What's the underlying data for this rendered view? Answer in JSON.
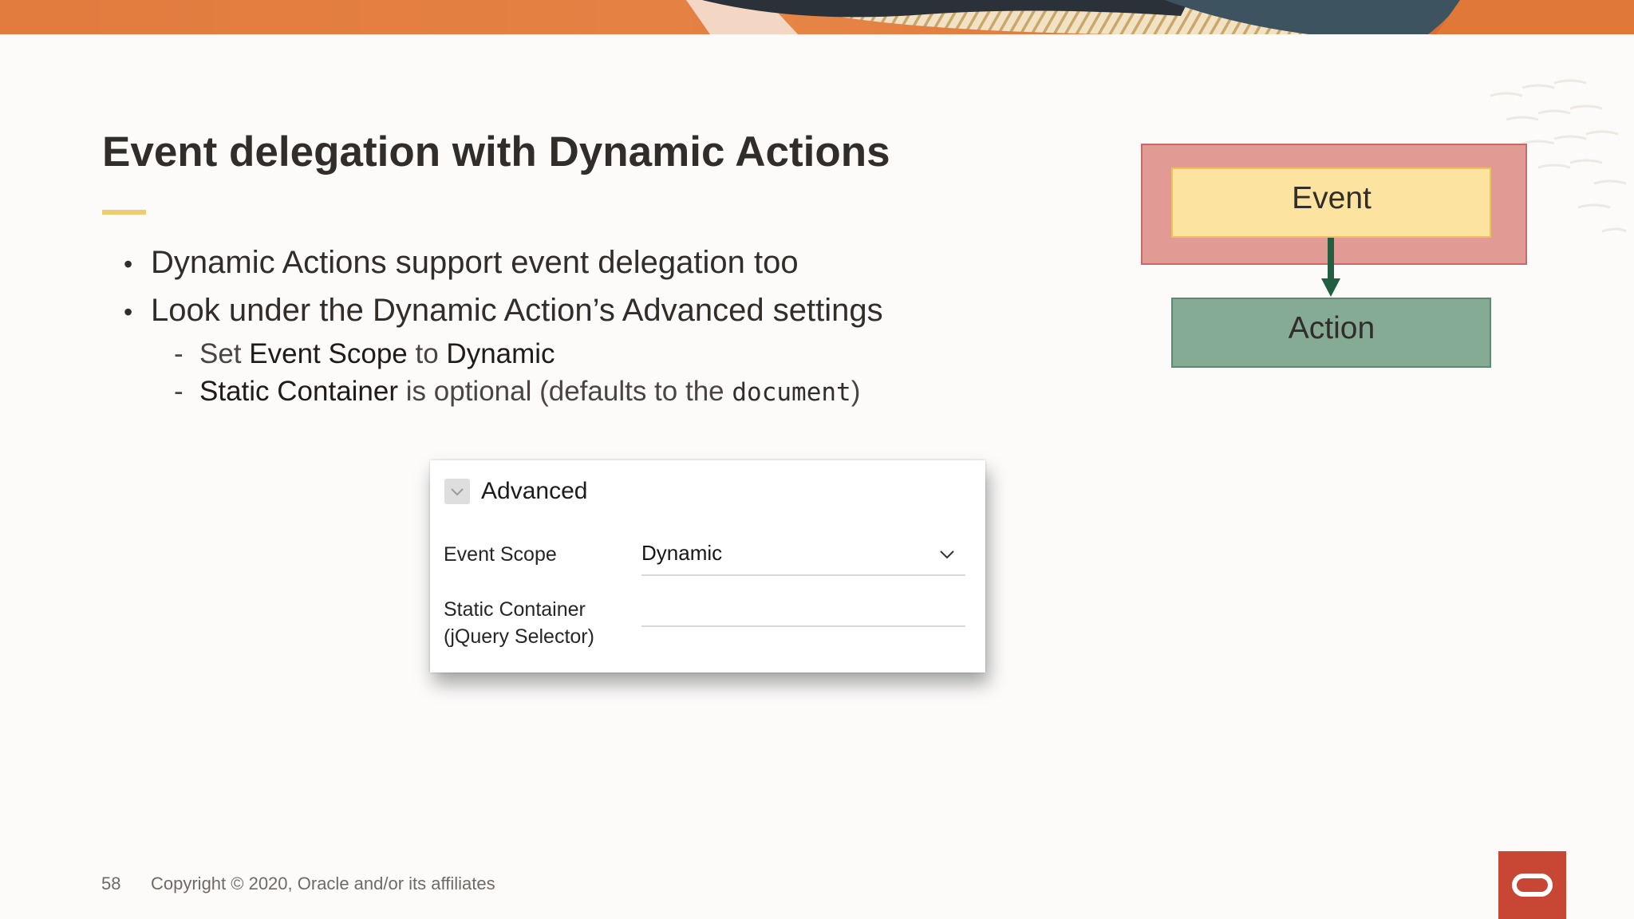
{
  "slide": {
    "title": "Event delegation with Dynamic Actions",
    "bullets": [
      "Dynamic Actions support event delegation too",
      "Look under the Dynamic Action’s Advanced settings"
    ],
    "sub1": {
      "pre": "Set",
      "term1": "Event Scope",
      "mid": "to",
      "term2": "Dynamic"
    },
    "sub2": {
      "term": "Static Container",
      "mid": "is optional (defaults to the",
      "code": "document",
      "close": ")"
    }
  },
  "advanced_panel": {
    "title": "Advanced",
    "event_scope_label": "Event Scope",
    "event_scope_value": "Dynamic",
    "static_container_label_line1": "Static Container",
    "static_container_label_line2": "(jQuery Selector)",
    "static_container_value": ""
  },
  "diagram": {
    "outer_label": "Event",
    "inner_label": "Action"
  },
  "footer": {
    "page_number": "58",
    "copyright": "Copyright © 2020, Oracle and/or its affiliates"
  },
  "colors": {
    "accent": "#f0cc71",
    "event_box_outer": "#e29a95",
    "event_box_inner": "#fde3a0",
    "action_box": "#86ab95",
    "arrow": "#225e42",
    "oracle_red": "#c74634"
  },
  "icons": {
    "panel_toggle": "chevron-down-icon",
    "select_arrow": "chevron-down-icon",
    "logo": "oracle-logo-icon"
  }
}
